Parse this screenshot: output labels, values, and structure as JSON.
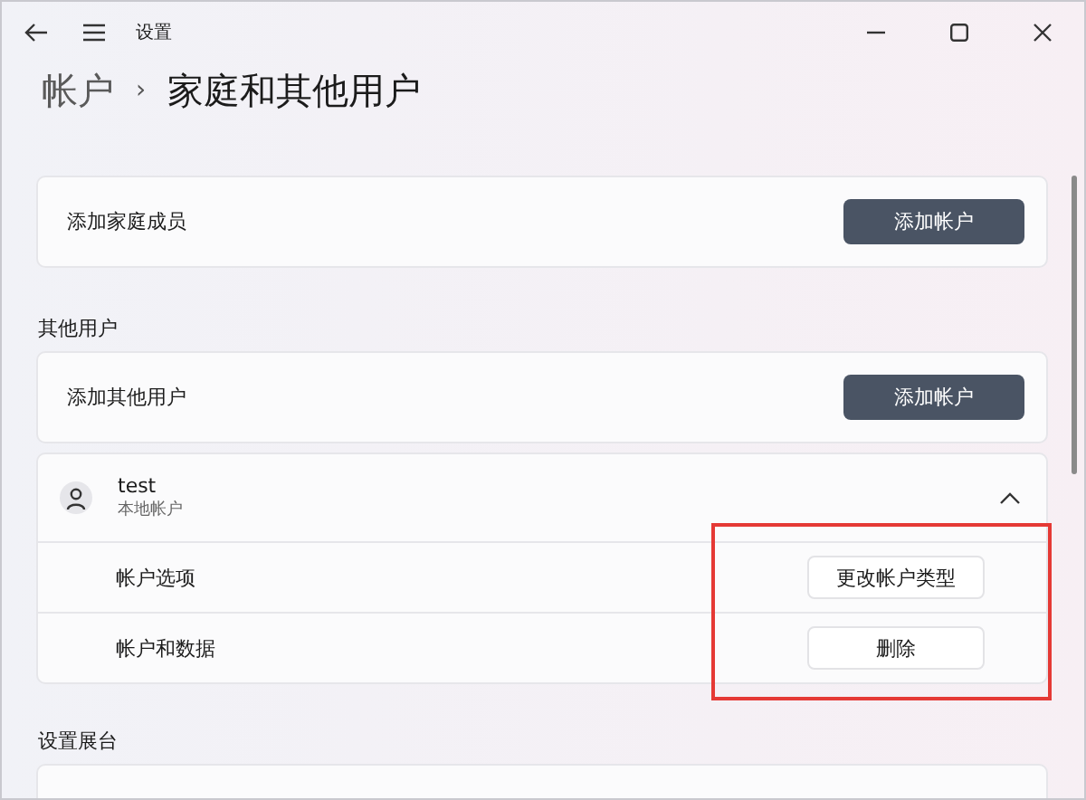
{
  "window": {
    "title": "设置"
  },
  "breadcrumb": {
    "parent": "帐户",
    "separator": "›",
    "current": "家庭和其他用户"
  },
  "family_card": {
    "label": "添加家庭成员",
    "button": "添加帐户"
  },
  "other_users": {
    "heading": "其他用户",
    "add_card": {
      "label": "添加其他用户",
      "button": "添加帐户"
    },
    "users": [
      {
        "name": "test",
        "subtitle": "本地帐户",
        "expanded": true,
        "rows": [
          {
            "label": "帐户选项",
            "button": "更改帐户类型"
          },
          {
            "label": "帐户和数据",
            "button": "删除"
          }
        ]
      }
    ]
  },
  "kiosk": {
    "heading": "设置展台"
  }
}
